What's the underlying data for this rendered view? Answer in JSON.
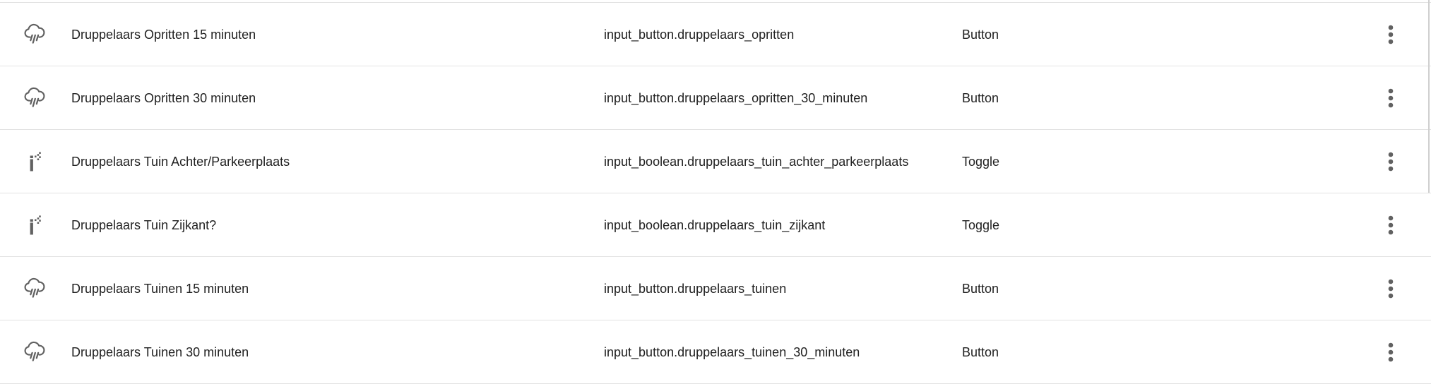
{
  "rows": [
    {
      "icon": "weather-pouring-icon",
      "name": "Druppelaars Opritten 15 minuten",
      "entity": "input_button.druppelaars_opritten",
      "type": "Button"
    },
    {
      "icon": "weather-pouring-icon",
      "name": "Druppelaars Opritten 30 minuten",
      "entity": "input_button.druppelaars_opritten_30_minuten",
      "type": "Button"
    },
    {
      "icon": "sprinkler-icon",
      "name": "Druppelaars Tuin Achter/Parkeerplaats",
      "entity": "input_boolean.druppelaars_tuin_achter_parkeerplaats",
      "type": "Toggle"
    },
    {
      "icon": "sprinkler-icon",
      "name": "Druppelaars Tuin Zijkant?",
      "entity": "input_boolean.druppelaars_tuin_zijkant",
      "type": "Toggle"
    },
    {
      "icon": "weather-pouring-icon",
      "name": "Druppelaars Tuinen 15 minuten",
      "entity": "input_button.druppelaars_tuinen",
      "type": "Button"
    },
    {
      "icon": "weather-pouring-icon",
      "name": "Druppelaars Tuinen 30 minuten",
      "entity": "input_button.druppelaars_tuinen_30_minuten",
      "type": "Button"
    }
  ],
  "colors": {
    "icon": "#616161",
    "text": "#212121",
    "divider": "#e2e2e2"
  }
}
